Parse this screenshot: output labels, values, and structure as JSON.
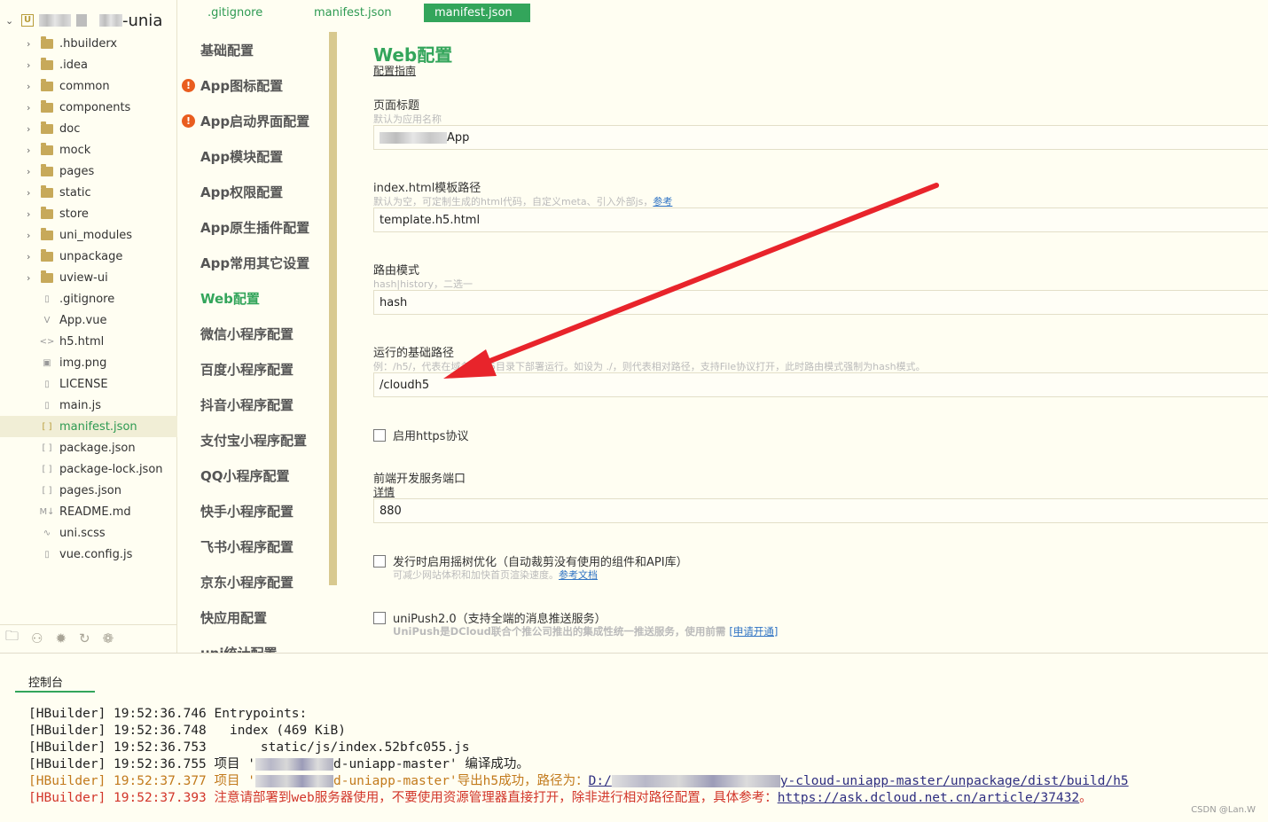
{
  "explorer": {
    "project_name": "-unia",
    "items": [
      {
        "label": ".hbuilderx",
        "type": "folder"
      },
      {
        "label": ".idea",
        "type": "folder"
      },
      {
        "label": "common",
        "type": "folder"
      },
      {
        "label": "components",
        "type": "folder"
      },
      {
        "label": "doc",
        "type": "folder"
      },
      {
        "label": "mock",
        "type": "folder"
      },
      {
        "label": "pages",
        "type": "folder"
      },
      {
        "label": "static",
        "type": "folder"
      },
      {
        "label": "store",
        "type": "folder"
      },
      {
        "label": "uni_modules",
        "type": "folder"
      },
      {
        "label": "unpackage",
        "type": "folder"
      },
      {
        "label": "uview-ui",
        "type": "folder"
      },
      {
        "label": ".gitignore",
        "type": "file"
      },
      {
        "label": "App.vue",
        "type": "file"
      },
      {
        "label": "h5.html",
        "type": "file"
      },
      {
        "label": "img.png",
        "type": "file"
      },
      {
        "label": "LICENSE",
        "type": "file"
      },
      {
        "label": "main.js",
        "type": "file"
      },
      {
        "label": "manifest.json",
        "type": "file"
      },
      {
        "label": "package.json",
        "type": "file"
      },
      {
        "label": "package-lock.json",
        "type": "file"
      },
      {
        "label": "pages.json",
        "type": "file"
      },
      {
        "label": "README.md",
        "type": "file"
      },
      {
        "label": "uni.scss",
        "type": "file"
      },
      {
        "label": "vue.config.js",
        "type": "file"
      }
    ],
    "active_item": "manifest.json"
  },
  "tabs": [
    {
      "label": ".gitignore"
    },
    {
      "label": "manifest.json"
    },
    {
      "label": "manifest.json"
    }
  ],
  "config_nav": [
    {
      "label": "基础配置"
    },
    {
      "label": "App图标配置"
    },
    {
      "label": "App启动界面配置"
    },
    {
      "label": "App模块配置"
    },
    {
      "label": "App权限配置"
    },
    {
      "label": "App原生插件配置"
    },
    {
      "label": "App常用其它设置"
    },
    {
      "label": "Web配置"
    },
    {
      "label": "微信小程序配置"
    },
    {
      "label": "百度小程序配置"
    },
    {
      "label": "抖音小程序配置"
    },
    {
      "label": "支付宝小程序配置"
    },
    {
      "label": "QQ小程序配置"
    },
    {
      "label": "快手小程序配置"
    },
    {
      "label": "飞书小程序配置"
    },
    {
      "label": "京东小程序配置"
    },
    {
      "label": "快应用配置"
    },
    {
      "label": "uni统计配置"
    }
  ],
  "form": {
    "title": "Web配置",
    "guide_link": "配置指南",
    "page_title_label": "页面标题",
    "page_title_hint": "默认为应用名称",
    "page_title_value": "App",
    "template_label": "index.html模板路径",
    "template_hint": "默认为空，可定制生成的html代码，自定义meta、引入外部js，",
    "template_hint_link": "参考",
    "template_value": "template.h5.html",
    "router_label": "路由模式",
    "router_hint": "hash|history，二选一",
    "router_value": "hash",
    "base_label": "运行的基础路径",
    "base_hint": "例：/h5/，代表在域名的/h5目录下部署运行。如设为 ./，则代表相对路径，支持File协议打开，此时路由模式强制为hash模式。",
    "base_value": "/cloudh5",
    "https_label": "启用https协议",
    "port_label": "前端开发服务端口",
    "port_link": "详情",
    "port_value": "880",
    "treeshake_label": "发行时启用摇树优化（自动裁剪没有使用的组件和API库）",
    "treeshake_hint": "可减少网站体积和加快首页渲染速度。",
    "treeshake_link": "参考文档",
    "unipush_label": "uniPush2.0（支持全端的消息推送服务）",
    "unipush_hint": "UniPush是DCloud联合个推公司推出的集成性统一推送服务，使用前需",
    "unipush_link": "[申请开通]"
  },
  "console": {
    "tab": "控制台",
    "lines": {
      "l1": "[HBuilder] 19:52:36.746 Entrypoints:",
      "l2": "[HBuilder] 19:52:36.748   index (469 KiB)",
      "l3": "[HBuilder] 19:52:36.753       static/js/index.52bfc055.js",
      "l4a": "[HBuilder] 19:52:36.755 项目 '",
      "l4b": "d-uniapp-master' 编译成功。",
      "l5a": "[HBuilder] 19:52:37.377 项目 '",
      "l5b": "d-uniapp-master'导出h5成功，路径为：",
      "l5c": "D:/",
      "l5d": "y-cloud-uniapp-master/unpackage/dist/build/h5",
      "l6a": "[HBuilder] 19:52:37.393 注意请部署到web服务器使用，不要使用资源管理器直接打开，除非进行相对路径配置，具体参考：",
      "l6b": "https://ask.dcloud.net.cn/article/37432",
      "l6c": "。"
    }
  },
  "watermark": "CSDN @Lan.W",
  "colors": {
    "accent": "#33a55b",
    "warning": "#e95d1f",
    "link": "#2f73c4",
    "arrow": "#e8242b"
  }
}
